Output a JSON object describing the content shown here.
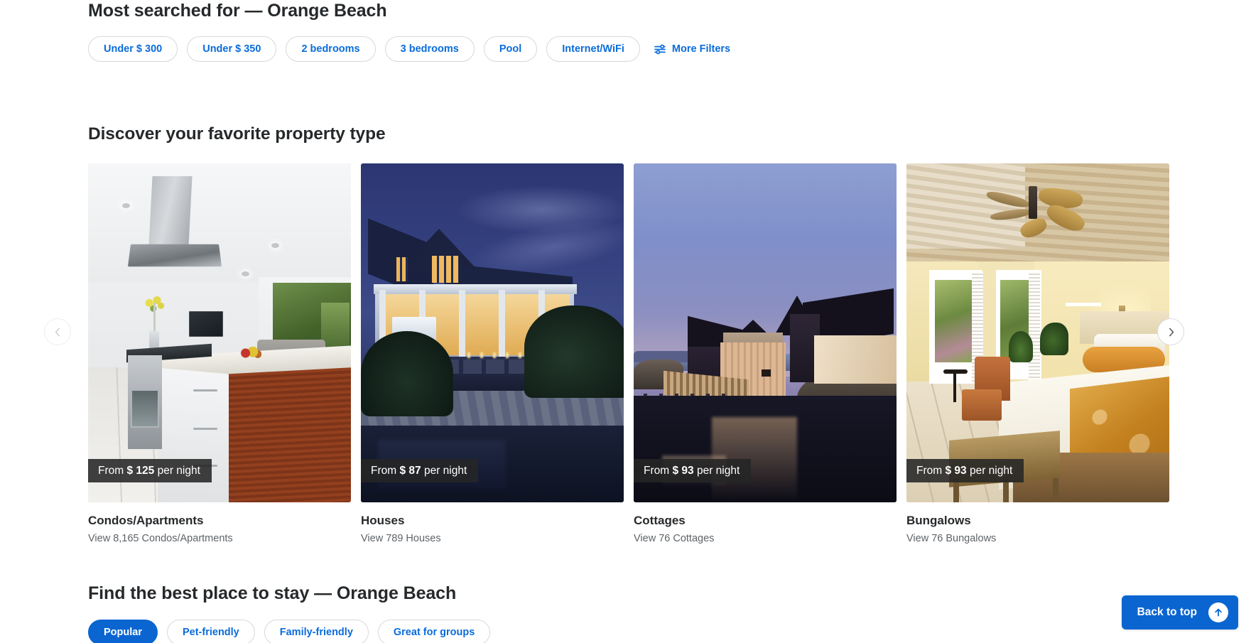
{
  "most_searched": {
    "title": "Most searched for — Orange Beach",
    "chips": [
      {
        "label": "Under $ 300"
      },
      {
        "label": "Under $ 350"
      },
      {
        "label": "2 bedrooms"
      },
      {
        "label": "3 bedrooms"
      },
      {
        "label": "Pool"
      },
      {
        "label": "Internet/WiFi"
      }
    ],
    "more_filters_label": "More Filters",
    "more_filters_icon": "filter-sliders-icon"
  },
  "discover": {
    "title": "Discover your favorite property type",
    "prev_icon": "chevron-left-icon",
    "next_icon": "chevron-right-icon",
    "cards": [
      {
        "price_prefix": "From",
        "price": "$ 125",
        "price_suffix": "per night",
        "title": "Condos/Apartments",
        "subtitle": "View 8,165 Condos/Apartments",
        "image_alt": "modern-white-kitchen-with-wood-island"
      },
      {
        "price_prefix": "From",
        "price": "$ 87",
        "price_suffix": "per night",
        "title": "Houses",
        "subtitle": "View 789 Houses",
        "image_alt": "white-gabled-house-at-dusk-with-pool"
      },
      {
        "price_prefix": "From",
        "price": "$ 93",
        "price_suffix": "per night",
        "title": "Cottages",
        "subtitle": "View 76 Cottages",
        "image_alt": "wooden-fishing-cottages-at-dusk-by-water"
      },
      {
        "price_prefix": "From",
        "price": "$ 93",
        "price_suffix": "per night",
        "title": "Bungalows",
        "subtitle": "View 76 Bungalows",
        "image_alt": "yellow-bedroom-with-ceiling-fan"
      }
    ]
  },
  "find_best": {
    "title": "Find the best place to stay — Orange Beach",
    "tabs": [
      {
        "label": "Popular",
        "selected": true
      },
      {
        "label": "Pet-friendly",
        "selected": false
      },
      {
        "label": "Family-friendly",
        "selected": false
      },
      {
        "label": "Great for groups",
        "selected": false
      }
    ]
  },
  "back_to_top": {
    "label": "Back to top",
    "icon": "arrow-up-icon"
  },
  "colors": {
    "accent_blue": "#0a65d1",
    "link_blue": "#0a6cdb",
    "text_dark": "#26292b",
    "text_muted": "#5e6468",
    "chip_border": "#d6d8db",
    "badge_bg": "#262626"
  }
}
